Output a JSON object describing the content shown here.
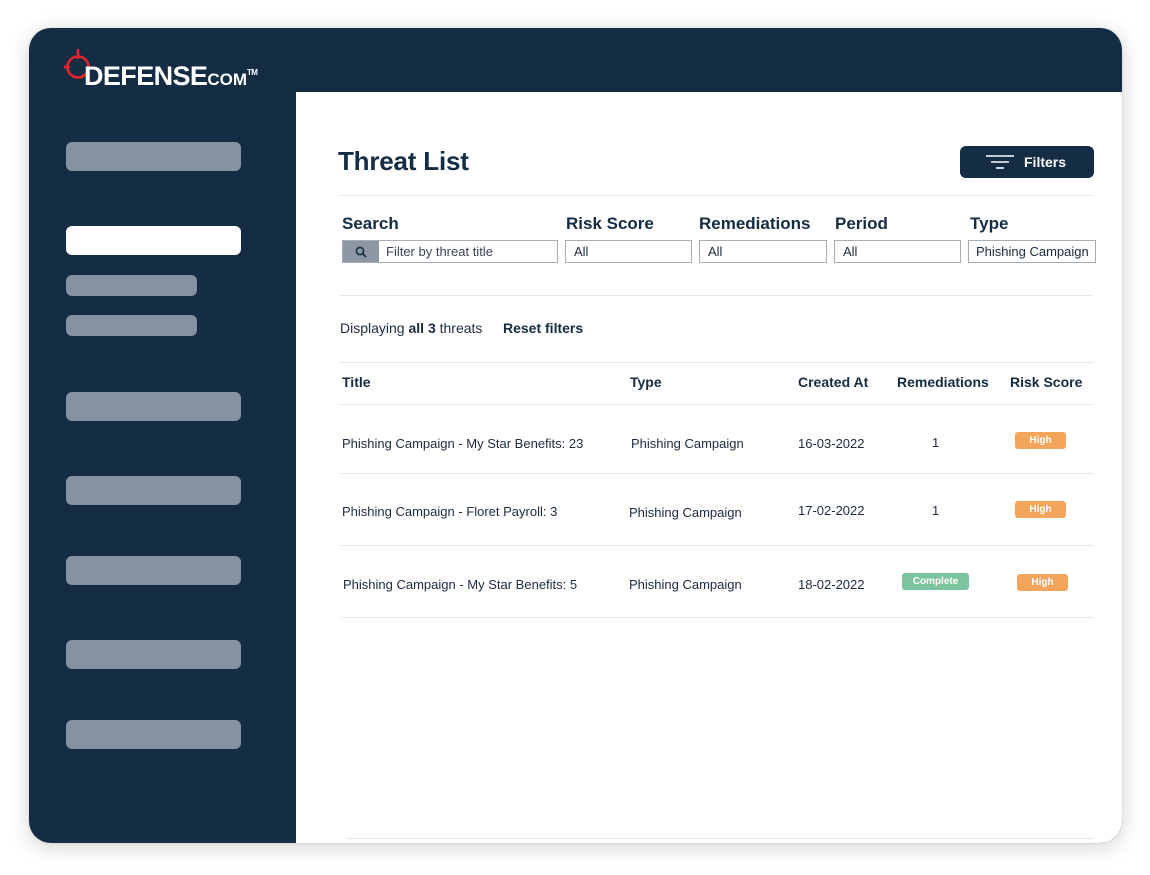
{
  "brand": {
    "name": "DEFENSE",
    "suffix": "COM",
    "tm": "TM"
  },
  "page": {
    "title": "Threat List",
    "filters_button": "Filters"
  },
  "filters": {
    "search": {
      "label": "Search",
      "placeholder": "Filter by threat title"
    },
    "risk_score": {
      "label": "Risk Score",
      "value": "All"
    },
    "remediations": {
      "label": "Remediations",
      "value": "All"
    },
    "period": {
      "label": "Period",
      "value": "All"
    },
    "type": {
      "label": "Type",
      "value": "Phishing Campaign"
    }
  },
  "summary": {
    "prefix": "Displaying",
    "count_text": "all 3",
    "suffix": "threats",
    "reset": "Reset filters"
  },
  "table": {
    "headers": {
      "title": "Title",
      "type": "Type",
      "created_at": "Created At",
      "remediations": "Remediations",
      "risk_score": "Risk Score"
    },
    "rows": [
      {
        "title": "Phishing Campaign - My Star Benefits: 23",
        "type": "Phishing Campaign",
        "created_at": "16-03-2022",
        "remediations": "1",
        "risk_score": "High"
      },
      {
        "title": "Phishing Campaign - Floret Payroll: 3",
        "type": "Phishing Campaign",
        "created_at": "17-02-2022",
        "remediations": "1",
        "risk_score": "High"
      },
      {
        "title": "Phishing Campaign - My Star Benefits: 5",
        "type": "Phishing Campaign",
        "created_at": "18-02-2022",
        "remediations": "Complete",
        "risk_score": "High"
      }
    ]
  },
  "colors": {
    "navy": "#142c44",
    "sidebar_pill": "#8792a0",
    "brand_red": "#e5252a",
    "high_badge": "#f4a55c",
    "complete_badge": "#7cc49e"
  }
}
